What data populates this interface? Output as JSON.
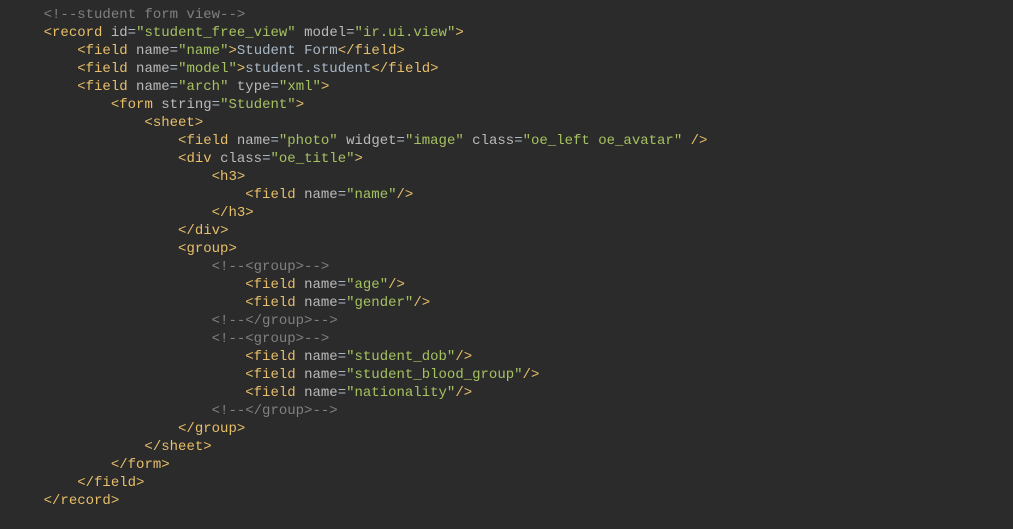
{
  "lines": [
    {
      "indent": 4,
      "segments": [
        {
          "cls": "comment",
          "t": "<!--student form view-->"
        }
      ]
    },
    {
      "indent": 4,
      "segments": [
        {
          "cls": "tag-bracket",
          "t": "<"
        },
        {
          "cls": "tag-name",
          "t": "record"
        },
        {
          "cls": "text-content",
          "t": " "
        },
        {
          "cls": "attr-name",
          "t": "id"
        },
        {
          "cls": "attr-eq",
          "t": "="
        },
        {
          "cls": "quote",
          "t": "\""
        },
        {
          "cls": "attr-value",
          "t": "student_free_view"
        },
        {
          "cls": "quote",
          "t": "\""
        },
        {
          "cls": "text-content",
          "t": " "
        },
        {
          "cls": "attr-name",
          "t": "model"
        },
        {
          "cls": "attr-eq",
          "t": "="
        },
        {
          "cls": "quote",
          "t": "\""
        },
        {
          "cls": "attr-value",
          "t": "ir.ui.view"
        },
        {
          "cls": "quote",
          "t": "\""
        },
        {
          "cls": "tag-bracket",
          "t": ">"
        }
      ]
    },
    {
      "indent": 8,
      "segments": [
        {
          "cls": "tag-bracket",
          "t": "<"
        },
        {
          "cls": "tag-name",
          "t": "field"
        },
        {
          "cls": "text-content",
          "t": " "
        },
        {
          "cls": "attr-name",
          "t": "name"
        },
        {
          "cls": "attr-eq",
          "t": "="
        },
        {
          "cls": "quote",
          "t": "\""
        },
        {
          "cls": "attr-value",
          "t": "name"
        },
        {
          "cls": "quote",
          "t": "\""
        },
        {
          "cls": "tag-bracket",
          "t": ">"
        },
        {
          "cls": "text-content",
          "t": "Student Form"
        },
        {
          "cls": "tag-bracket",
          "t": "</"
        },
        {
          "cls": "tag-name",
          "t": "field"
        },
        {
          "cls": "tag-bracket",
          "t": ">"
        }
      ]
    },
    {
      "indent": 8,
      "segments": [
        {
          "cls": "tag-bracket",
          "t": "<"
        },
        {
          "cls": "tag-name",
          "t": "field"
        },
        {
          "cls": "text-content",
          "t": " "
        },
        {
          "cls": "attr-name",
          "t": "name"
        },
        {
          "cls": "attr-eq",
          "t": "="
        },
        {
          "cls": "quote",
          "t": "\""
        },
        {
          "cls": "attr-value",
          "t": "model"
        },
        {
          "cls": "quote",
          "t": "\""
        },
        {
          "cls": "tag-bracket",
          "t": ">"
        },
        {
          "cls": "text-content",
          "t": "student.student"
        },
        {
          "cls": "tag-bracket",
          "t": "</"
        },
        {
          "cls": "tag-name",
          "t": "field"
        },
        {
          "cls": "tag-bracket",
          "t": ">"
        }
      ]
    },
    {
      "indent": 8,
      "segments": [
        {
          "cls": "tag-bracket",
          "t": "<"
        },
        {
          "cls": "tag-name",
          "t": "field"
        },
        {
          "cls": "text-content",
          "t": " "
        },
        {
          "cls": "attr-name",
          "t": "name"
        },
        {
          "cls": "attr-eq",
          "t": "="
        },
        {
          "cls": "quote",
          "t": "\""
        },
        {
          "cls": "attr-value",
          "t": "arch"
        },
        {
          "cls": "quote",
          "t": "\""
        },
        {
          "cls": "text-content",
          "t": " "
        },
        {
          "cls": "attr-name",
          "t": "type"
        },
        {
          "cls": "attr-eq",
          "t": "="
        },
        {
          "cls": "quote",
          "t": "\""
        },
        {
          "cls": "attr-value",
          "t": "xml"
        },
        {
          "cls": "quote",
          "t": "\""
        },
        {
          "cls": "tag-bracket",
          "t": ">"
        }
      ]
    },
    {
      "indent": 12,
      "segments": [
        {
          "cls": "tag-bracket",
          "t": "<"
        },
        {
          "cls": "tag-name",
          "t": "form"
        },
        {
          "cls": "text-content",
          "t": " "
        },
        {
          "cls": "attr-name",
          "t": "string"
        },
        {
          "cls": "attr-eq",
          "t": "="
        },
        {
          "cls": "quote",
          "t": "\""
        },
        {
          "cls": "attr-value",
          "t": "Student"
        },
        {
          "cls": "quote",
          "t": "\""
        },
        {
          "cls": "tag-bracket",
          "t": ">"
        }
      ]
    },
    {
      "indent": 16,
      "segments": [
        {
          "cls": "tag-bracket",
          "t": "<"
        },
        {
          "cls": "tag-name",
          "t": "sheet"
        },
        {
          "cls": "tag-bracket",
          "t": ">"
        }
      ]
    },
    {
      "indent": 20,
      "segments": [
        {
          "cls": "tag-bracket",
          "t": "<"
        },
        {
          "cls": "tag-name",
          "t": "field"
        },
        {
          "cls": "text-content",
          "t": " "
        },
        {
          "cls": "attr-name",
          "t": "name"
        },
        {
          "cls": "attr-eq",
          "t": "="
        },
        {
          "cls": "quote",
          "t": "\""
        },
        {
          "cls": "attr-value",
          "t": "photo"
        },
        {
          "cls": "quote",
          "t": "\""
        },
        {
          "cls": "text-content",
          "t": " "
        },
        {
          "cls": "attr-name",
          "t": "widget"
        },
        {
          "cls": "attr-eq",
          "t": "="
        },
        {
          "cls": "quote",
          "t": "\""
        },
        {
          "cls": "attr-value",
          "t": "image"
        },
        {
          "cls": "quote",
          "t": "\""
        },
        {
          "cls": "text-content",
          "t": " "
        },
        {
          "cls": "attr-name",
          "t": "class"
        },
        {
          "cls": "attr-eq",
          "t": "="
        },
        {
          "cls": "quote",
          "t": "\""
        },
        {
          "cls": "attr-value",
          "t": "oe_left oe_avatar"
        },
        {
          "cls": "quote",
          "t": "\""
        },
        {
          "cls": "text-content",
          "t": " "
        },
        {
          "cls": "tag-bracket",
          "t": "/>"
        }
      ]
    },
    {
      "indent": 20,
      "segments": [
        {
          "cls": "tag-bracket",
          "t": "<"
        },
        {
          "cls": "tag-name",
          "t": "div"
        },
        {
          "cls": "text-content",
          "t": " "
        },
        {
          "cls": "attr-name",
          "t": "class"
        },
        {
          "cls": "attr-eq",
          "t": "="
        },
        {
          "cls": "quote",
          "t": "\""
        },
        {
          "cls": "attr-value",
          "t": "oe_title"
        },
        {
          "cls": "quote",
          "t": "\""
        },
        {
          "cls": "tag-bracket",
          "t": ">"
        }
      ]
    },
    {
      "indent": 24,
      "segments": [
        {
          "cls": "tag-bracket",
          "t": "<"
        },
        {
          "cls": "tag-name",
          "t": "h3"
        },
        {
          "cls": "tag-bracket",
          "t": ">"
        }
      ]
    },
    {
      "indent": 28,
      "segments": [
        {
          "cls": "tag-bracket",
          "t": "<"
        },
        {
          "cls": "tag-name",
          "t": "field"
        },
        {
          "cls": "text-content",
          "t": " "
        },
        {
          "cls": "attr-name",
          "t": "name"
        },
        {
          "cls": "attr-eq",
          "t": "="
        },
        {
          "cls": "quote",
          "t": "\""
        },
        {
          "cls": "attr-value",
          "t": "name"
        },
        {
          "cls": "quote",
          "t": "\""
        },
        {
          "cls": "tag-bracket",
          "t": "/>"
        }
      ]
    },
    {
      "indent": 24,
      "segments": [
        {
          "cls": "tag-bracket",
          "t": "</"
        },
        {
          "cls": "tag-name",
          "t": "h3"
        },
        {
          "cls": "tag-bracket",
          "t": ">"
        }
      ]
    },
    {
      "indent": 20,
      "segments": [
        {
          "cls": "tag-bracket",
          "t": "</"
        },
        {
          "cls": "tag-name",
          "t": "div"
        },
        {
          "cls": "tag-bracket",
          "t": ">"
        }
      ]
    },
    {
      "indent": 20,
      "segments": [
        {
          "cls": "tag-bracket",
          "t": "<"
        },
        {
          "cls": "tag-name",
          "t": "group"
        },
        {
          "cls": "tag-bracket",
          "t": ">"
        }
      ]
    },
    {
      "indent": 24,
      "segments": [
        {
          "cls": "comment",
          "t": "<!--<group>-->"
        }
      ]
    },
    {
      "indent": 28,
      "segments": [
        {
          "cls": "tag-bracket",
          "t": "<"
        },
        {
          "cls": "tag-name",
          "t": "field"
        },
        {
          "cls": "text-content",
          "t": " "
        },
        {
          "cls": "attr-name",
          "t": "name"
        },
        {
          "cls": "attr-eq",
          "t": "="
        },
        {
          "cls": "quote",
          "t": "\""
        },
        {
          "cls": "attr-value",
          "t": "age"
        },
        {
          "cls": "quote",
          "t": "\""
        },
        {
          "cls": "tag-bracket",
          "t": "/>"
        }
      ]
    },
    {
      "indent": 28,
      "segments": [
        {
          "cls": "tag-bracket",
          "t": "<"
        },
        {
          "cls": "tag-name",
          "t": "field"
        },
        {
          "cls": "text-content",
          "t": " "
        },
        {
          "cls": "attr-name",
          "t": "name"
        },
        {
          "cls": "attr-eq",
          "t": "="
        },
        {
          "cls": "quote",
          "t": "\""
        },
        {
          "cls": "attr-value",
          "t": "gender"
        },
        {
          "cls": "quote",
          "t": "\""
        },
        {
          "cls": "tag-bracket",
          "t": "/>"
        }
      ]
    },
    {
      "indent": 24,
      "segments": [
        {
          "cls": "comment",
          "t": "<!--</group>-->"
        }
      ]
    },
    {
      "indent": 24,
      "segments": [
        {
          "cls": "comment",
          "t": "<!--<group>-->"
        }
      ]
    },
    {
      "indent": 28,
      "segments": [
        {
          "cls": "tag-bracket",
          "t": "<"
        },
        {
          "cls": "tag-name",
          "t": "field"
        },
        {
          "cls": "text-content",
          "t": " "
        },
        {
          "cls": "attr-name",
          "t": "name"
        },
        {
          "cls": "attr-eq",
          "t": "="
        },
        {
          "cls": "quote",
          "t": "\""
        },
        {
          "cls": "attr-value",
          "t": "student_dob"
        },
        {
          "cls": "quote",
          "t": "\""
        },
        {
          "cls": "tag-bracket",
          "t": "/>"
        }
      ]
    },
    {
      "indent": 28,
      "segments": [
        {
          "cls": "tag-bracket",
          "t": "<"
        },
        {
          "cls": "tag-name",
          "t": "field"
        },
        {
          "cls": "text-content",
          "t": " "
        },
        {
          "cls": "attr-name",
          "t": "name"
        },
        {
          "cls": "attr-eq",
          "t": "="
        },
        {
          "cls": "quote",
          "t": "\""
        },
        {
          "cls": "attr-value",
          "t": "student_blood_group"
        },
        {
          "cls": "quote",
          "t": "\""
        },
        {
          "cls": "tag-bracket",
          "t": "/>"
        }
      ]
    },
    {
      "indent": 28,
      "segments": [
        {
          "cls": "tag-bracket",
          "t": "<"
        },
        {
          "cls": "tag-name",
          "t": "field"
        },
        {
          "cls": "text-content",
          "t": " "
        },
        {
          "cls": "attr-name",
          "t": "name"
        },
        {
          "cls": "attr-eq",
          "t": "="
        },
        {
          "cls": "quote",
          "t": "\""
        },
        {
          "cls": "attr-value",
          "t": "nationality"
        },
        {
          "cls": "quote",
          "t": "\""
        },
        {
          "cls": "tag-bracket",
          "t": "/>"
        }
      ]
    },
    {
      "indent": 24,
      "segments": [
        {
          "cls": "comment",
          "t": "<!--</group>-->"
        }
      ]
    },
    {
      "indent": 20,
      "segments": [
        {
          "cls": "tag-bracket",
          "t": "</"
        },
        {
          "cls": "tag-name",
          "t": "group"
        },
        {
          "cls": "tag-bracket",
          "t": ">"
        }
      ]
    },
    {
      "indent": 16,
      "segments": [
        {
          "cls": "tag-bracket",
          "t": "</"
        },
        {
          "cls": "tag-name",
          "t": "sheet"
        },
        {
          "cls": "tag-bracket",
          "t": ">"
        }
      ]
    },
    {
      "indent": 12,
      "segments": [
        {
          "cls": "tag-bracket",
          "t": "</"
        },
        {
          "cls": "tag-name",
          "t": "form"
        },
        {
          "cls": "tag-bracket",
          "t": ">"
        }
      ]
    },
    {
      "indent": 8,
      "segments": [
        {
          "cls": "tag-bracket",
          "t": "</"
        },
        {
          "cls": "tag-name",
          "t": "field"
        },
        {
          "cls": "tag-bracket",
          "t": ">"
        }
      ]
    },
    {
      "indent": 4,
      "segments": [
        {
          "cls": "tag-bracket",
          "t": "</"
        },
        {
          "cls": "tag-name",
          "t": "record"
        },
        {
          "cls": "tag-bracket",
          "t": ">"
        }
      ]
    }
  ]
}
